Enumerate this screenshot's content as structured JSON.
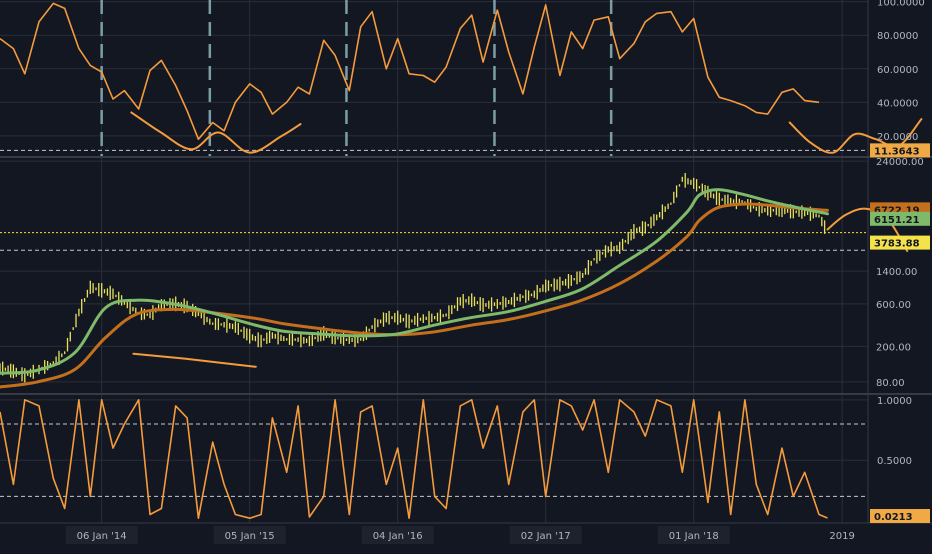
{
  "colors": {
    "background": "#131722",
    "grid": "#2a2e39",
    "separator": "#363a45",
    "axis_text": "#b2b5be",
    "orange": "#f59b3c",
    "price_bar": "#e9e25a",
    "green_ma": "#7fba6a",
    "brown_ma": "#c46f1c",
    "marker_line": "#7a9ea3",
    "last_label_bg": "#f0a945"
  },
  "x_axis": {
    "labels": [
      "06 Jan '14",
      "05 Jan '15",
      "04 Jan '16",
      "02 Jan '17",
      "01 Jan '18",
      "2019"
    ],
    "label_dates": [
      "2014-01-06",
      "2015-01-05",
      "2016-01-04",
      "2017-01-02",
      "2018-01-01",
      "2019-01-01"
    ],
    "range": [
      "2013-05-01",
      "2019-08-10"
    ]
  },
  "chart_data": [
    {
      "type": "line",
      "panel": "top-oscillator",
      "ylim": [
        8,
        101
      ],
      "y_ticks": [
        "100.0000",
        "80.0000",
        "60.0000",
        "40.0000",
        "20.0000"
      ],
      "last_value_label": "11.3643",
      "threshold": 11.3643,
      "cycle_marker_dates": [
        "2014-01-06",
        "2014-09-29",
        "2015-08-31",
        "2016-08-29",
        "2017-06-12"
      ],
      "series": [
        {
          "x": [
            "2013-05-01",
            "2013-06-03",
            "2013-07-01",
            "2013-08-05",
            "2013-09-09",
            "2013-10-07",
            "2013-11-11",
            "2013-12-09",
            "2014-01-06",
            "2014-02-03",
            "2014-03-03",
            "2014-04-07",
            "2014-05-05",
            "2014-06-02",
            "2014-07-07",
            "2014-08-04",
            "2014-09-01",
            "2014-10-06",
            "2014-11-03",
            "2014-12-01",
            "2015-01-05",
            "2015-02-02",
            "2015-03-02",
            "2015-04-06",
            "2015-05-04",
            "2015-06-01",
            "2015-07-06",
            "2015-08-03",
            "2015-09-07",
            "2015-10-05",
            "2015-11-02",
            "2015-12-07",
            "2016-01-04",
            "2016-02-01",
            "2016-03-07",
            "2016-04-04",
            "2016-05-02",
            "2016-06-06",
            "2016-07-04",
            "2016-08-01",
            "2016-09-05",
            "2016-10-03",
            "2016-11-07",
            "2016-12-05",
            "2017-01-02",
            "2017-02-06",
            "2017-03-06",
            "2017-04-03",
            "2017-05-01",
            "2017-06-05",
            "2017-07-03",
            "2017-08-07",
            "2017-09-04",
            "2017-10-02",
            "2017-11-06",
            "2017-12-04",
            "2018-01-01",
            "2018-02-05",
            "2018-03-05",
            "2018-04-02",
            "2018-05-07",
            "2018-06-04",
            "2018-07-02",
            "2018-08-06",
            "2018-09-03",
            "2018-10-01",
            "2018-11-05"
          ],
          "values": [
            78,
            72,
            57,
            88,
            99,
            96,
            72,
            62,
            58,
            42,
            47,
            36,
            59,
            65,
            50,
            35,
            18,
            28,
            23,
            40,
            51,
            46,
            33,
            40,
            49,
            45,
            77,
            68,
            47,
            85,
            94,
            60,
            78,
            57,
            56,
            52,
            61,
            84,
            92,
            64,
            95,
            70,
            45,
            73,
            98,
            56,
            82,
            72,
            89,
            91,
            66,
            75,
            88,
            93,
            94,
            82,
            90,
            55,
            43,
            41,
            38,
            34,
            33,
            46,
            48,
            41,
            40
          ]
        }
      ],
      "hand_drawn_curves": [
        {
          "x": [
            "2014-03-20",
            "2014-06-01",
            "2014-08-15",
            "2014-10-20",
            "2015-01-05",
            "2015-03-25",
            "2015-05-10"
          ],
          "values": [
            34,
            22,
            12,
            22,
            10,
            20,
            27
          ]
        },
        {
          "x": [
            "2018-08-25",
            "2018-10-15",
            "2018-12-10",
            "2019-02-01",
            "2019-03-25",
            "2019-05-20",
            "2019-07-15"
          ],
          "values": [
            28,
            16,
            10,
            21,
            18,
            14,
            30
          ]
        }
      ]
    },
    {
      "type": "line",
      "panel": "price",
      "scale": "log",
      "ylim": [
        60,
        26000
      ],
      "y_ticks": [
        "24000.00",
        "1400.00",
        "600.00",
        "200.00",
        "80.00"
      ],
      "price_labels": {
        "brown_ma": "6722.19",
        "green_ma": "6151.21",
        "hidden_tick": "6600.00",
        "current_price": "3783.88"
      },
      "current_price": 3783.88,
      "reference_level": 2400,
      "series": [
        {
          "x": [
            "2013-05-01",
            "2013-06-03",
            "2013-07-01",
            "2013-08-05",
            "2013-09-09",
            "2013-10-07",
            "2013-11-11",
            "2013-12-09",
            "2014-01-06",
            "2014-02-03",
            "2014-03-03",
            "2014-04-07",
            "2014-05-05",
            "2014-06-02",
            "2014-07-07",
            "2014-08-04",
            "2014-09-01",
            "2014-10-06",
            "2014-11-03",
            "2014-12-01",
            "2015-01-05",
            "2015-02-02",
            "2015-03-02",
            "2015-04-06",
            "2015-05-04",
            "2015-06-01",
            "2015-07-06",
            "2015-08-03",
            "2015-09-07",
            "2015-10-05",
            "2015-11-02",
            "2015-12-07",
            "2016-01-04",
            "2016-02-01",
            "2016-03-07",
            "2016-04-04",
            "2016-05-02",
            "2016-06-06",
            "2016-07-04",
            "2016-08-01",
            "2016-09-05",
            "2016-10-03",
            "2016-11-07",
            "2016-12-05",
            "2017-01-02",
            "2017-02-06",
            "2017-03-06",
            "2017-04-03",
            "2017-05-01",
            "2017-06-05",
            "2017-07-03",
            "2017-08-07",
            "2017-09-04",
            "2017-10-02",
            "2017-11-06",
            "2017-12-04",
            "2018-01-01",
            "2018-02-05",
            "2018-03-05",
            "2018-04-02",
            "2018-05-07",
            "2018-06-04",
            "2018-07-02",
            "2018-08-06",
            "2018-09-03",
            "2018-10-01",
            "2018-11-05",
            "2018-11-26"
          ],
          "values": [
            115,
            105,
            95,
            110,
            130,
            170,
            480,
            920,
            850,
            780,
            620,
            470,
            450,
            580,
            600,
            560,
            470,
            360,
            350,
            330,
            260,
            230,
            265,
            240,
            238,
            230,
            280,
            250,
            235,
            240,
            330,
            420,
            420,
            380,
            410,
            420,
            450,
            640,
            660,
            580,
            600,
            630,
            720,
            770,
            950,
            1000,
            1100,
            1250,
            1900,
            2450,
            2550,
            3900,
            4300,
            5600,
            8000,
            15000,
            13500,
            10500,
            9000,
            8500,
            8200,
            7000,
            6700,
            6800,
            6500,
            6400,
            5800,
            3783.88
          ]
        },
        {
          "name": "green_ma",
          "x": [
            "2013-05-01",
            "2013-08-01",
            "2013-11-01",
            "2014-01-15",
            "2014-04-01",
            "2014-07-01",
            "2014-10-01",
            "2015-01-15",
            "2015-04-01",
            "2015-07-01",
            "2015-10-01",
            "2016-01-01",
            "2016-04-01",
            "2016-07-01",
            "2016-10-01",
            "2017-01-01",
            "2017-04-01",
            "2017-07-01",
            "2017-10-01",
            "2017-12-15",
            "2018-01-15",
            "2018-03-01",
            "2018-05-01",
            "2018-07-01",
            "2018-09-01",
            "2018-11-26"
          ],
          "values": [
            100,
            108,
            170,
            540,
            660,
            600,
            480,
            350,
            295,
            275,
            262,
            275,
            345,
            420,
            490,
            640,
            880,
            1600,
            3000,
            6400,
            10000,
            11500,
            10200,
            8600,
            7400,
            6151.21
          ]
        },
        {
          "name": "brown_ma",
          "x": [
            "2013-05-01",
            "2013-08-01",
            "2013-11-01",
            "2014-01-15",
            "2014-04-01",
            "2014-07-01",
            "2014-10-01",
            "2015-01-15",
            "2015-04-01",
            "2015-07-01",
            "2015-10-01",
            "2016-01-01",
            "2016-04-01",
            "2016-07-01",
            "2016-10-01",
            "2017-01-01",
            "2017-04-01",
            "2017-07-01",
            "2017-10-01",
            "2017-12-15",
            "2018-01-15",
            "2018-03-01",
            "2018-05-01",
            "2018-07-01",
            "2018-09-01",
            "2018-11-26"
          ],
          "values": [
            70,
            80,
            110,
            250,
            460,
            520,
            480,
            415,
            358,
            315,
            283,
            270,
            290,
            345,
            400,
            500,
            660,
            1000,
            1800,
            3400,
            5200,
            7200,
            7900,
            7700,
            7200,
            6722.19
          ]
        }
      ],
      "hand_drawn_curves": [
        {
          "x": [
            "2014-03-25",
            "2014-08-01",
            "2015-01-20"
          ],
          "values": [
            165,
            145,
            118
          ]
        },
        {
          "x": [
            "2018-11-26",
            "2019-01-10",
            "2019-03-01",
            "2019-04-25",
            "2019-06-10"
          ],
          "values": [
            4100,
            6000,
            7000,
            5200,
            2350
          ]
        }
      ]
    },
    {
      "type": "line",
      "panel": "bottom-oscillator",
      "ylim": [
        -0.02,
        1.04
      ],
      "y_ticks": [
        "1.0000",
        "0.5000"
      ],
      "last_value_label": "0.0213",
      "dashed_levels": [
        0.8,
        0.2
      ],
      "series": [
        {
          "x": [
            "2013-05-01",
            "2013-06-03",
            "2013-07-01",
            "2013-08-05",
            "2013-09-09",
            "2013-10-07",
            "2013-11-11",
            "2013-12-09",
            "2014-01-06",
            "2014-02-03",
            "2014-03-03",
            "2014-04-07",
            "2014-05-05",
            "2014-06-02",
            "2014-07-07",
            "2014-08-04",
            "2014-09-01",
            "2014-10-06",
            "2014-11-03",
            "2014-12-01",
            "2015-01-05",
            "2015-02-02",
            "2015-03-02",
            "2015-04-06",
            "2015-05-04",
            "2015-06-01",
            "2015-07-06",
            "2015-08-03",
            "2015-09-07",
            "2015-10-05",
            "2015-11-02",
            "2015-12-07",
            "2016-01-04",
            "2016-02-01",
            "2016-03-07",
            "2016-04-04",
            "2016-05-02",
            "2016-06-06",
            "2016-07-04",
            "2016-08-01",
            "2016-09-05",
            "2016-10-03",
            "2016-11-07",
            "2016-12-05",
            "2017-01-02",
            "2017-02-06",
            "2017-03-06",
            "2017-04-03",
            "2017-05-01",
            "2017-06-05",
            "2017-07-03",
            "2017-08-07",
            "2017-09-04",
            "2017-10-02",
            "2017-11-06",
            "2017-12-04",
            "2018-01-01",
            "2018-02-05",
            "2018-03-05",
            "2018-04-02",
            "2018-05-07",
            "2018-06-04",
            "2018-07-02",
            "2018-08-06",
            "2018-09-03",
            "2018-10-01",
            "2018-11-05",
            "2018-11-26"
          ],
          "values": [
            0.9,
            0.3,
            1.0,
            0.95,
            0.35,
            0.1,
            1.0,
            0.2,
            1.0,
            0.6,
            0.8,
            1.0,
            0.05,
            0.1,
            0.95,
            0.85,
            0.02,
            0.65,
            0.3,
            0.05,
            0.02,
            0.05,
            0.85,
            0.4,
            0.95,
            0.03,
            0.2,
            1.0,
            0.05,
            0.9,
            0.95,
            0.3,
            0.6,
            0.02,
            1.0,
            0.2,
            0.1,
            0.95,
            1.0,
            0.6,
            0.95,
            0.3,
            0.9,
            1.0,
            0.2,
            1.0,
            0.95,
            0.75,
            1.0,
            0.4,
            1.0,
            0.9,
            0.7,
            1.0,
            0.95,
            0.4,
            1.0,
            0.15,
            0.9,
            0.05,
            1.0,
            0.3,
            0.05,
            0.6,
            0.2,
            0.4,
            0.05,
            0.0213
          ]
        }
      ]
    }
  ]
}
